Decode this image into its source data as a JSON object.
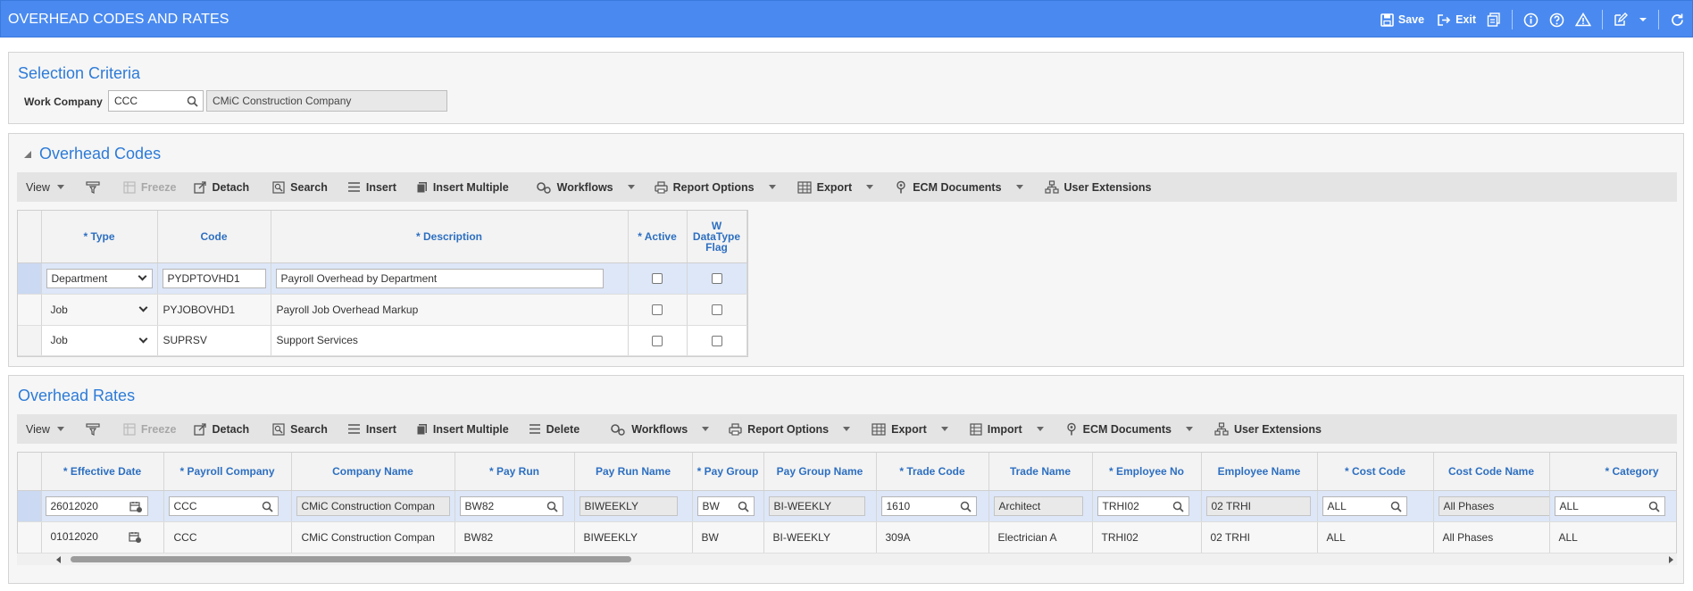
{
  "header": {
    "title": "OVERHEAD CODES AND RATES",
    "save_label": "Save",
    "exit_label": "Exit",
    "color": "#4a8af0"
  },
  "selection": {
    "title": "Selection Criteria",
    "work_company_label": "Work Company",
    "work_company_value": "CCC",
    "work_company_name": "CMiC Construction Company"
  },
  "overhead_codes": {
    "title": "Overhead Codes",
    "toolbar": {
      "view": "View",
      "freeze": "Freeze",
      "detach": "Detach",
      "search": "Search",
      "insert": "Insert",
      "insert_multiple": "Insert Multiple",
      "workflows": "Workflows",
      "report_options": "Report Options",
      "export": "Export",
      "ecm_documents": "ECM Documents",
      "user_extensions": "User Extensions"
    },
    "columns": {
      "type": "* Type",
      "code": "Code",
      "description": "* Description",
      "active": "* Active",
      "w1": "W",
      "w2": "DataType",
      "w3": "Flag"
    },
    "rows": [
      {
        "type": "Department",
        "code": "PYDPTOVHD1",
        "description": "Payroll Overhead by Department",
        "active": false,
        "flag": false
      },
      {
        "type": "Job",
        "code": "PYJOBOVHD1",
        "description": "Payroll Job Overhead Markup",
        "active": false,
        "flag": false
      },
      {
        "type": "Job",
        "code": "SUPRSV",
        "description": "Support Services",
        "active": false,
        "flag": false
      }
    ]
  },
  "overhead_rates": {
    "title": "Overhead Rates",
    "toolbar": {
      "view": "View",
      "freeze": "Freeze",
      "detach": "Detach",
      "search": "Search",
      "insert": "Insert",
      "insert_multiple": "Insert Multiple",
      "delete": "Delete",
      "workflows": "Workflows",
      "report_options": "Report Options",
      "export": "Export",
      "import": "Import",
      "ecm_documents": "ECM Documents",
      "user_extensions": "User Extensions"
    },
    "columns": {
      "effective_date": "* Effective Date",
      "payroll_company": "* Payroll Company",
      "company_name": "Company Name",
      "pay_run": "* Pay Run",
      "pay_run_name": "Pay Run Name",
      "pay_group": "* Pay Group",
      "pay_group_name": "Pay Group Name",
      "trade_code": "* Trade Code",
      "trade_name": "Trade Name",
      "employee_no": "* Employee No",
      "employee_name": "Employee Name",
      "cost_code": "* Cost Code",
      "cost_code_name": "Cost Code Name",
      "category": "* Category"
    },
    "rows": [
      {
        "effective_date": "26012020",
        "payroll_company": "CCC",
        "company_name": "CMiC Construction Compan",
        "pay_run": "BW82",
        "pay_run_name": "BIWEEKLY",
        "pay_group": "BW",
        "pay_group_name": "BI-WEEKLY",
        "trade_code": "1610",
        "trade_name": "Architect",
        "employee_no": "TRHI02",
        "employee_name": "02 TRHI",
        "cost_code": "ALL",
        "cost_code_name": "All Phases",
        "category": "ALL"
      },
      {
        "effective_date": "01012020",
        "payroll_company": "CCC",
        "company_name": "CMiC Construction Compan",
        "pay_run": "BW82",
        "pay_run_name": "BIWEEKLY",
        "pay_group": "BW",
        "pay_group_name": "BI-WEEKLY",
        "trade_code": "309A",
        "trade_name": "Electrician A",
        "employee_no": "TRHI02",
        "employee_name": "02 TRHI",
        "cost_code": "ALL",
        "cost_code_name": "All Phases",
        "category": "ALL"
      }
    ]
  }
}
